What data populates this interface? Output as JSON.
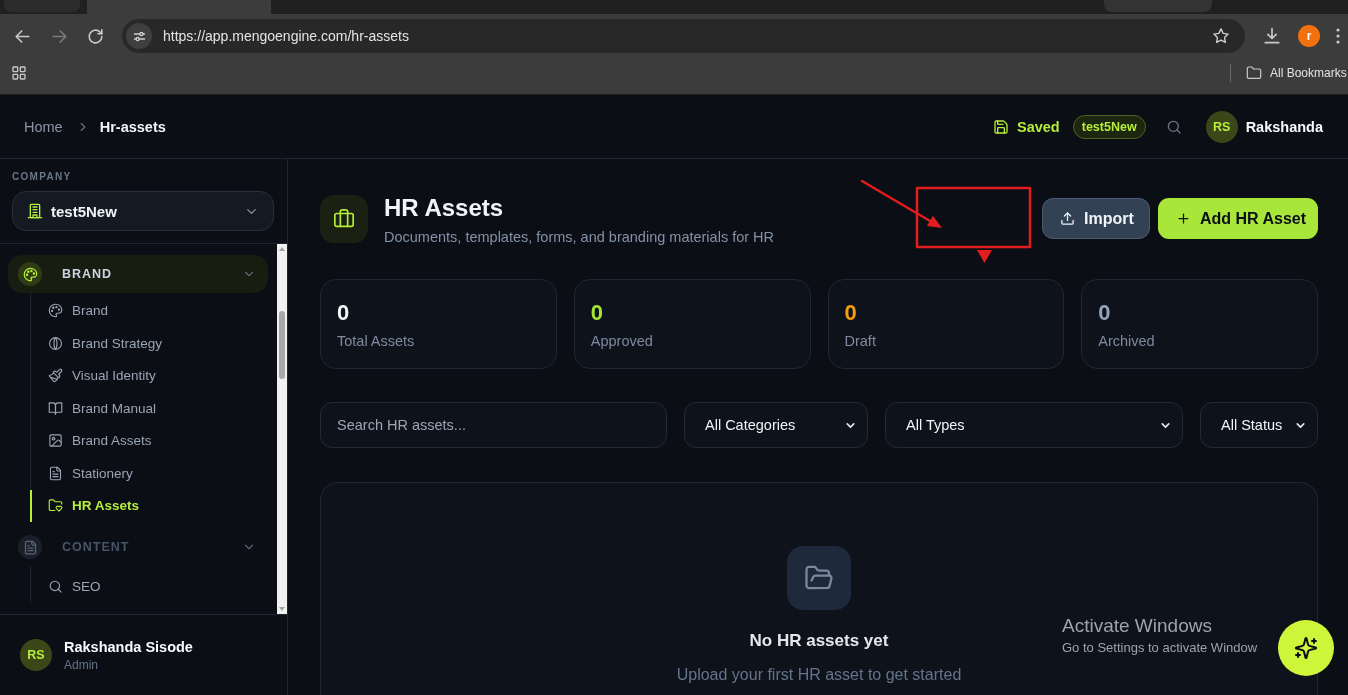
{
  "browser": {
    "url": "https://app.mengoengine.com/hr-assets",
    "profile_initial": "r",
    "bookmarks": "All Bookmarks"
  },
  "header": {
    "breadcrumb": [
      {
        "label": "Home",
        "current": false
      },
      {
        "label": "Hr-assets",
        "current": true
      }
    ],
    "status": "Saved",
    "workspace": "test5New",
    "user": {
      "initials": "RS",
      "name": "Rakshanda"
    }
  },
  "sidebar": {
    "section_label": "COMPANY",
    "company": "test5New",
    "groups": [
      {
        "label": "BRAND",
        "active": true,
        "expanded": true,
        "children": [
          {
            "label": "Brand",
            "selected": false
          },
          {
            "label": "Brand Strategy",
            "selected": false
          },
          {
            "label": "Visual Identity",
            "selected": false
          },
          {
            "label": "Brand Manual",
            "selected": false
          },
          {
            "label": "Brand Assets",
            "selected": false
          },
          {
            "label": "Stationery",
            "selected": false
          },
          {
            "label": "HR Assets",
            "selected": true
          }
        ]
      },
      {
        "label": "CONTENT",
        "active": false,
        "expanded": true,
        "children": [
          {
            "label": "SEO",
            "selected": false
          }
        ]
      }
    ],
    "profile": {
      "initials": "RS",
      "name": "Rakshanda Sisode",
      "role": "Admin"
    }
  },
  "page": {
    "title": "HR Assets",
    "subtitle": "Documents, templates, forms, and branding materials for HR",
    "actions": [
      {
        "label": "Import",
        "kind": "secondary"
      },
      {
        "label": "Add HR Asset",
        "kind": "primary"
      }
    ]
  },
  "stats": [
    {
      "value": "0",
      "label": "Total Assets",
      "color": "#f1f5f9"
    },
    {
      "value": "0",
      "label": "Approved",
      "color": "#a3e635"
    },
    {
      "value": "0",
      "label": "Draft",
      "color": "#f59e0b"
    },
    {
      "value": "0",
      "label": "Archived",
      "color": "#94a3b8"
    }
  ],
  "filters": {
    "search": {
      "placeholder": "Search HR assets..."
    },
    "selects": [
      {
        "value": "All Categories"
      },
      {
        "value": "All Types"
      },
      {
        "value": "All Status"
      }
    ]
  },
  "empty_state": {
    "title": "No HR assets yet",
    "message": "Upload your first HR asset to get started"
  },
  "os_notice": {
    "title": "Activate Windows",
    "message": "Go to Settings to activate Window"
  }
}
